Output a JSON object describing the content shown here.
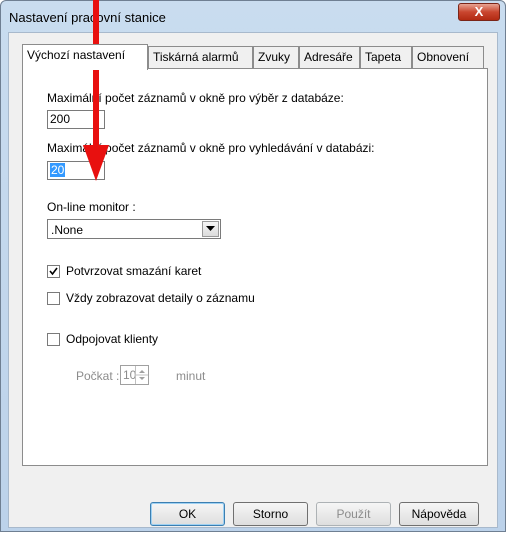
{
  "window": {
    "title": "Nastavení pracovní stanice",
    "close_label": "X"
  },
  "tabs": [
    {
      "label": "Výchozí nastavení"
    },
    {
      "label": "Tiskárná alarmů"
    },
    {
      "label": "Zvuky"
    },
    {
      "label": "Adresáře"
    },
    {
      "label": "Tapeta"
    },
    {
      "label": "Obnovení"
    }
  ],
  "settings": {
    "max_select_label": "Maximální počet záznamů v okně pro výběr z databáze:",
    "max_select_value": "200",
    "max_search_label": "Maximální počet záznamů v okně pro vyhledávání v databázi:",
    "max_search_value": "20",
    "monitor_label": "On-line monitor :",
    "monitor_value": ".None",
    "confirm_delete_label": "Potvrzovat smazání karet",
    "confirm_delete_checked": true,
    "show_details_label": "Vždy zobrazovat detaily o záznamu",
    "show_details_checked": false,
    "disconnect_label": "Odpojovat klienty",
    "disconnect_checked": false,
    "wait_label": "Počkat :",
    "wait_value": "10",
    "wait_unit": "minut"
  },
  "buttons": {
    "ok": "OK",
    "cancel": "Storno",
    "apply": "Použít",
    "help": "Nápověda"
  },
  "annotation": {
    "arrow_color": "#e8100f"
  }
}
